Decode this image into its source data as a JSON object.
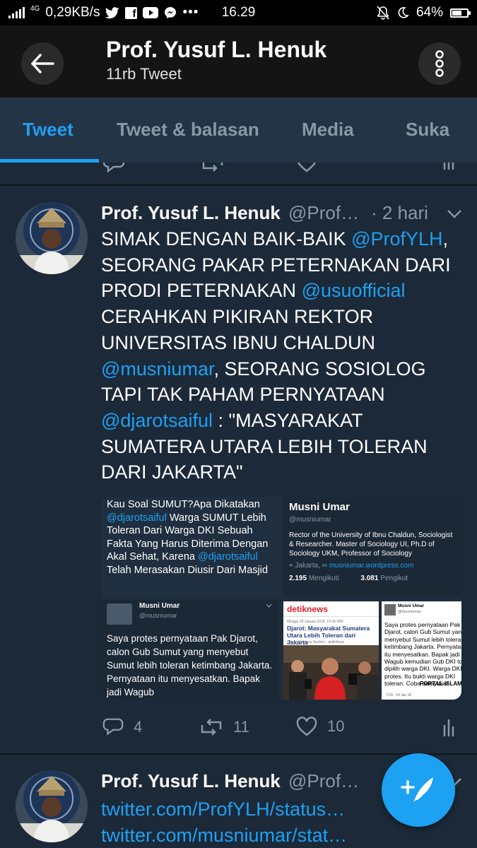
{
  "status_bar": {
    "network": "4G",
    "speed": "0,29KB/s",
    "time": "16.29",
    "battery": "64%",
    "battery_level": 0.64
  },
  "header": {
    "title": "Prof. Yusuf L. Henuk",
    "subtitle": "11rb Tweet"
  },
  "tabs": [
    {
      "label": "Tweet",
      "active": true
    },
    {
      "label": "Tweet & balasan",
      "active": false
    },
    {
      "label": "Media",
      "active": false
    },
    {
      "label": "Suka",
      "active": false
    }
  ],
  "tweet": {
    "name": "Prof. Yusuf L. Henuk",
    "handle": "@Prof…",
    "time": "· 2 hari",
    "text": {
      "p1": "SIMAK DENGAN BAIK-BAIK ",
      "m1": "@ProfYLH",
      "p2": ", SEORANG PAKAR PETERNAKAN DARI PRODI PETERNAKAN ",
      "m2": "@usuofficial",
      "p3": " CERAHKAN PIKIRAN REKTOR UNIVERSITAS IBNU CHALDUN ",
      "m3": "@musniumar",
      "p4": ", SEORANG SOSIOLOG TAPI TAK PAHAM PERNYATAAN ",
      "m4": "@djarotsaiful",
      "p5": " : \"MASYARAKAT SUMATERA UTARA LEBIH TOLERAN DARI JAKARTA\""
    },
    "media": {
      "m1": {
        "l1": "Kau Soal SUMUT?Apa Dikatakan",
        "mention1": "@djarotsaiful",
        "l2": " Warga SUMUT Lebih Toleran Dari Warga DKI Sebuah Fakta Yang Harus Diterima Dengan Akal Sehat, Karena ",
        "mention2": "@djarotsaiful",
        "l3": " Telah Merasakan Diusir Dari Masjid"
      },
      "m2": {
        "name": "Musni Umar",
        "handle": "@musniumar",
        "bio": "Rector of the University of Ibnu Chaldun, Sociologist & Researcher. Master of Sociology UI, Ph.D of Sociology UKM, Professor of Sociology",
        "location": "Jakarta,",
        "website": "musniumar.wordpress.com",
        "following_count": "2.195",
        "following_label": "Mengikuti",
        "followers_count": "3.081",
        "followers_label": "Pengikut"
      },
      "m3": {
        "name": "Musni Umar",
        "handle": "@musniumar",
        "text": "Saya protes pernyataan Pak Djarot, calon Gub Sumut yang menyebut Sumut lebih toleran ketimbang Jakarta. Pernyataan itu menyesatkan. Bapak jadi Wagub"
      },
      "m4": {
        "brand": "detiknews",
        "date": "Minggu 28 Januari 2018, 19:39 WIB",
        "headline": "Djarot: Masyarakat Sumatera Utara Lebih Toleran dari Jakarta",
        "byline": "Gibran Maulana Ibrahim - detikNews"
      },
      "m5": {
        "name": "Musni Umar",
        "handle": "@musniumar",
        "text": "Saya protes pernyataan Pak Djarot, calon Gub Sumut yang menyebut Sumut lebih toleran ketimbang Jakarta. Pernyataan itu menyesatkan. Bapak jadi Wagub kemudian Gub DKI tdk dipilih warga DKI. Warga DKI tdk protes. Itu bukti warga DKI toleran. Coba bersyukur",
        "watermark": "PORTAL-ISLAM",
        "time": "7:03 - 24 Jan 18"
      }
    },
    "actions": {
      "replies": "4",
      "retweets": "11",
      "likes": "10"
    }
  },
  "tweet2": {
    "name": "Prof. Yusuf L. Henuk",
    "handle": "@Prof…",
    "link1": "twitter.com/ProfYLH/status…",
    "link2": "twitter.com/musniumar/stat…"
  },
  "colors": {
    "background": "#1c2938",
    "accent": "#1da1f2",
    "muted": "#8899a6"
  }
}
